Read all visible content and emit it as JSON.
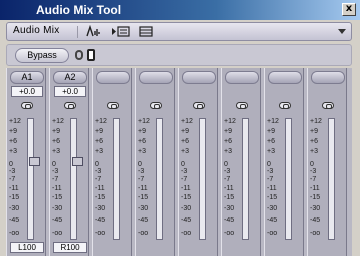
{
  "window": {
    "title": "Audio Mix Tool",
    "close_label": "x"
  },
  "toolbar": {
    "label": "Audio Mix"
  },
  "controls": {
    "bypass_label": "Bypass"
  },
  "scale_ticks": [
    "+12",
    "+9",
    "+6",
    "+3",
    "0",
    "-3",
    "-7",
    "-11",
    "-15",
    "-30",
    "-45",
    "-oo"
  ],
  "channels": [
    {
      "name": "A1",
      "gain": "+0.0",
      "pan": "L100"
    },
    {
      "name": "A2",
      "gain": "+0.0",
      "pan": "R100"
    },
    {
      "name": "",
      "gain": "",
      "pan": ""
    },
    {
      "name": "",
      "gain": "",
      "pan": ""
    },
    {
      "name": "",
      "gain": "",
      "pan": ""
    },
    {
      "name": "",
      "gain": "",
      "pan": ""
    },
    {
      "name": "",
      "gain": "",
      "pan": ""
    },
    {
      "name": "",
      "gain": "",
      "pan": ""
    }
  ]
}
